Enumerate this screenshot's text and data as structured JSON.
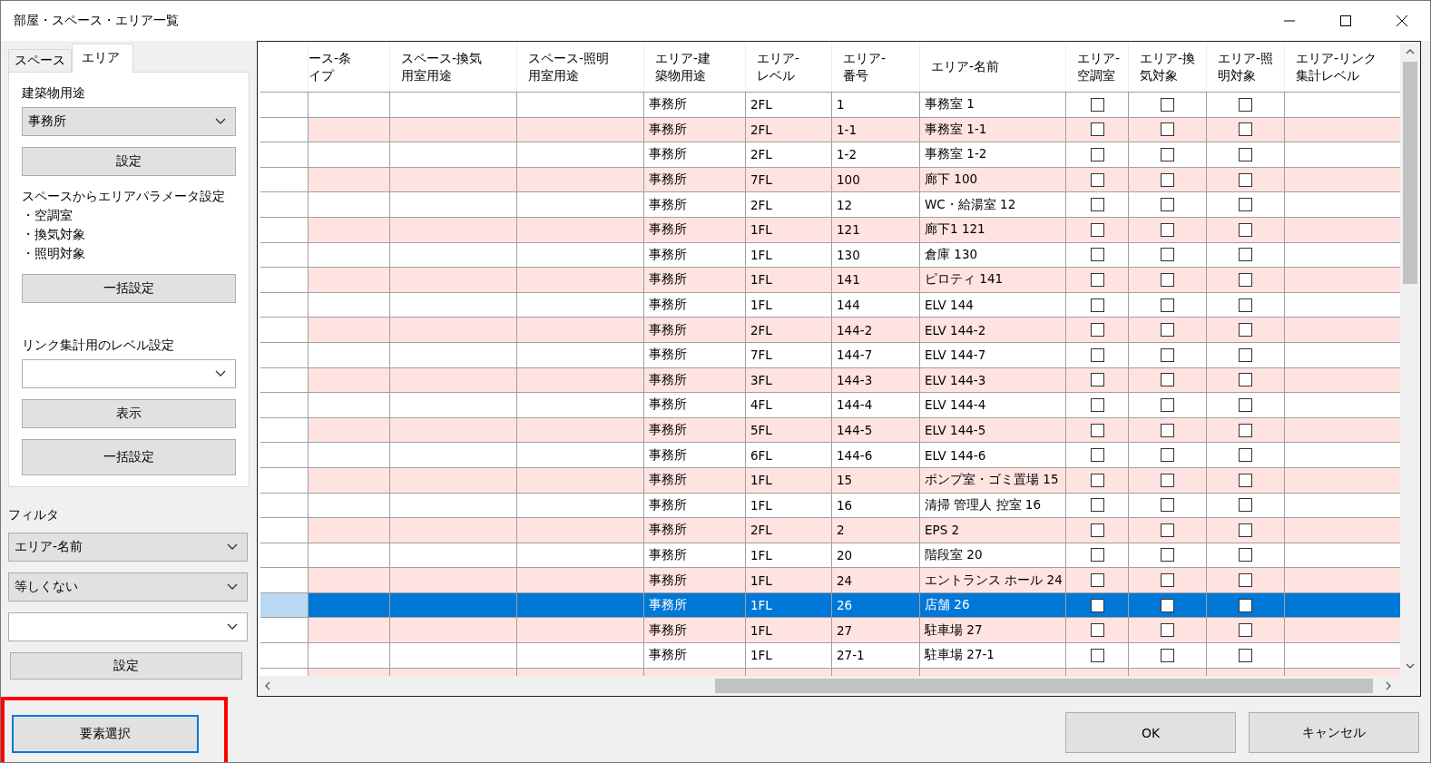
{
  "window": {
    "title": "部屋・スペース・エリア一覧"
  },
  "tabs": [
    {
      "label": "スペース",
      "selected": false
    },
    {
      "label": "エリア",
      "selected": true
    }
  ],
  "area_panel": {
    "building_use_label": "建築物用途",
    "building_use_value": "事務所",
    "set_button": "設定",
    "param_heading": "スペースからエリアパラメータ設定",
    "param_items": [
      "・空調室",
      "・換気対象",
      "・照明対象"
    ],
    "bulk_button": "一括設定",
    "link_level_label": "リンク集計用のレベル設定",
    "show_button": "表示",
    "bulk_button_2": "一括設定"
  },
  "filter": {
    "label": "フィルタ",
    "field_value": "エリア-名前",
    "condition_value": "等しくない",
    "set_button": "設定"
  },
  "element_select_button": {
    "label": "要素選択",
    "highlighted": true
  },
  "table": {
    "columns": [
      "ース-条イプ",
      "スペース-換気用室用途",
      "スペース-照明用室用途",
      "エリア-建築物用途",
      "エリア-レベル",
      "エリア-番号",
      "エリア-名前",
      "エリア-空調室",
      "エリア-換気対象",
      "エリア-照明対象",
      "エリア-リンク集計レベル"
    ],
    "rows": [
      {
        "cells": [
          "",
          "",
          "",
          "事務所",
          "2FL",
          "1",
          "事務室 1"
        ],
        "ac": false,
        "vent": false,
        "light": false,
        "selected": false
      },
      {
        "cells": [
          "",
          "",
          "",
          "事務所",
          "2FL",
          "1-1",
          "事務室 1-1"
        ],
        "ac": false,
        "vent": false,
        "light": false,
        "selected": false
      },
      {
        "cells": [
          "",
          "",
          "",
          "事務所",
          "2FL",
          "1-2",
          "事務室 1-2"
        ],
        "ac": false,
        "vent": false,
        "light": false,
        "selected": false
      },
      {
        "cells": [
          "",
          "",
          "",
          "事務所",
          "7FL",
          "100",
          "廊下 100"
        ],
        "ac": false,
        "vent": false,
        "light": false,
        "selected": false
      },
      {
        "cells": [
          "",
          "",
          "",
          "事務所",
          "2FL",
          "12",
          "WC・給湯室 12"
        ],
        "ac": false,
        "vent": false,
        "light": false,
        "selected": false
      },
      {
        "cells": [
          "",
          "",
          "",
          "事務所",
          "1FL",
          "121",
          "廊下1 121"
        ],
        "ac": false,
        "vent": false,
        "light": false,
        "selected": false
      },
      {
        "cells": [
          "",
          "",
          "",
          "事務所",
          "1FL",
          "130",
          "倉庫 130"
        ],
        "ac": false,
        "vent": false,
        "light": false,
        "selected": false
      },
      {
        "cells": [
          "",
          "",
          "",
          "事務所",
          "1FL",
          "141",
          "ピロティ 141"
        ],
        "ac": false,
        "vent": false,
        "light": false,
        "selected": false
      },
      {
        "cells": [
          "",
          "",
          "",
          "事務所",
          "1FL",
          "144",
          "ELV 144"
        ],
        "ac": false,
        "vent": false,
        "light": false,
        "selected": false
      },
      {
        "cells": [
          "",
          "",
          "",
          "事務所",
          "2FL",
          "144-2",
          "ELV 144-2"
        ],
        "ac": false,
        "vent": false,
        "light": false,
        "selected": false
      },
      {
        "cells": [
          "",
          "",
          "",
          "事務所",
          "7FL",
          "144-7",
          "ELV 144-7"
        ],
        "ac": false,
        "vent": false,
        "light": false,
        "selected": false
      },
      {
        "cells": [
          "",
          "",
          "",
          "事務所",
          "3FL",
          "144-3",
          "ELV 144-3"
        ],
        "ac": false,
        "vent": false,
        "light": false,
        "selected": false
      },
      {
        "cells": [
          "",
          "",
          "",
          "事務所",
          "4FL",
          "144-4",
          "ELV 144-4"
        ],
        "ac": false,
        "vent": false,
        "light": false,
        "selected": false
      },
      {
        "cells": [
          "",
          "",
          "",
          "事務所",
          "5FL",
          "144-5",
          "ELV 144-5"
        ],
        "ac": false,
        "vent": false,
        "light": false,
        "selected": false
      },
      {
        "cells": [
          "",
          "",
          "",
          "事務所",
          "6FL",
          "144-6",
          "ELV 144-6"
        ],
        "ac": false,
        "vent": false,
        "light": false,
        "selected": false
      },
      {
        "cells": [
          "",
          "",
          "",
          "事務所",
          "1FL",
          "15",
          "ポンプ室・ゴミ置場 15"
        ],
        "ac": false,
        "vent": false,
        "light": false,
        "selected": false
      },
      {
        "cells": [
          "",
          "",
          "",
          "事務所",
          "1FL",
          "16",
          "清掃 管理人 控室 16"
        ],
        "ac": false,
        "vent": false,
        "light": false,
        "selected": false
      },
      {
        "cells": [
          "",
          "",
          "",
          "事務所",
          "2FL",
          "2",
          "EPS 2"
        ],
        "ac": false,
        "vent": false,
        "light": false,
        "selected": false
      },
      {
        "cells": [
          "",
          "",
          "",
          "事務所",
          "1FL",
          "20",
          "階段室 20"
        ],
        "ac": false,
        "vent": false,
        "light": false,
        "selected": false
      },
      {
        "cells": [
          "",
          "",
          "",
          "事務所",
          "1FL",
          "24",
          "エントランス ホール 24"
        ],
        "ac": false,
        "vent": false,
        "light": false,
        "selected": false
      },
      {
        "cells": [
          "",
          "",
          "",
          "事務所",
          "1FL",
          "26",
          "店舗 26"
        ],
        "ac": false,
        "vent": false,
        "light": false,
        "selected": true
      },
      {
        "cells": [
          "",
          "",
          "",
          "事務所",
          "1FL",
          "27",
          "駐車場 27"
        ],
        "ac": false,
        "vent": false,
        "light": false,
        "selected": false
      },
      {
        "cells": [
          "",
          "",
          "",
          "事務所",
          "1FL",
          "27-1",
          "駐車場 27-1"
        ],
        "ac": false,
        "vent": false,
        "light": false,
        "selected": false
      }
    ]
  },
  "buttons": [
    "OK",
    "キャンセル"
  ]
}
